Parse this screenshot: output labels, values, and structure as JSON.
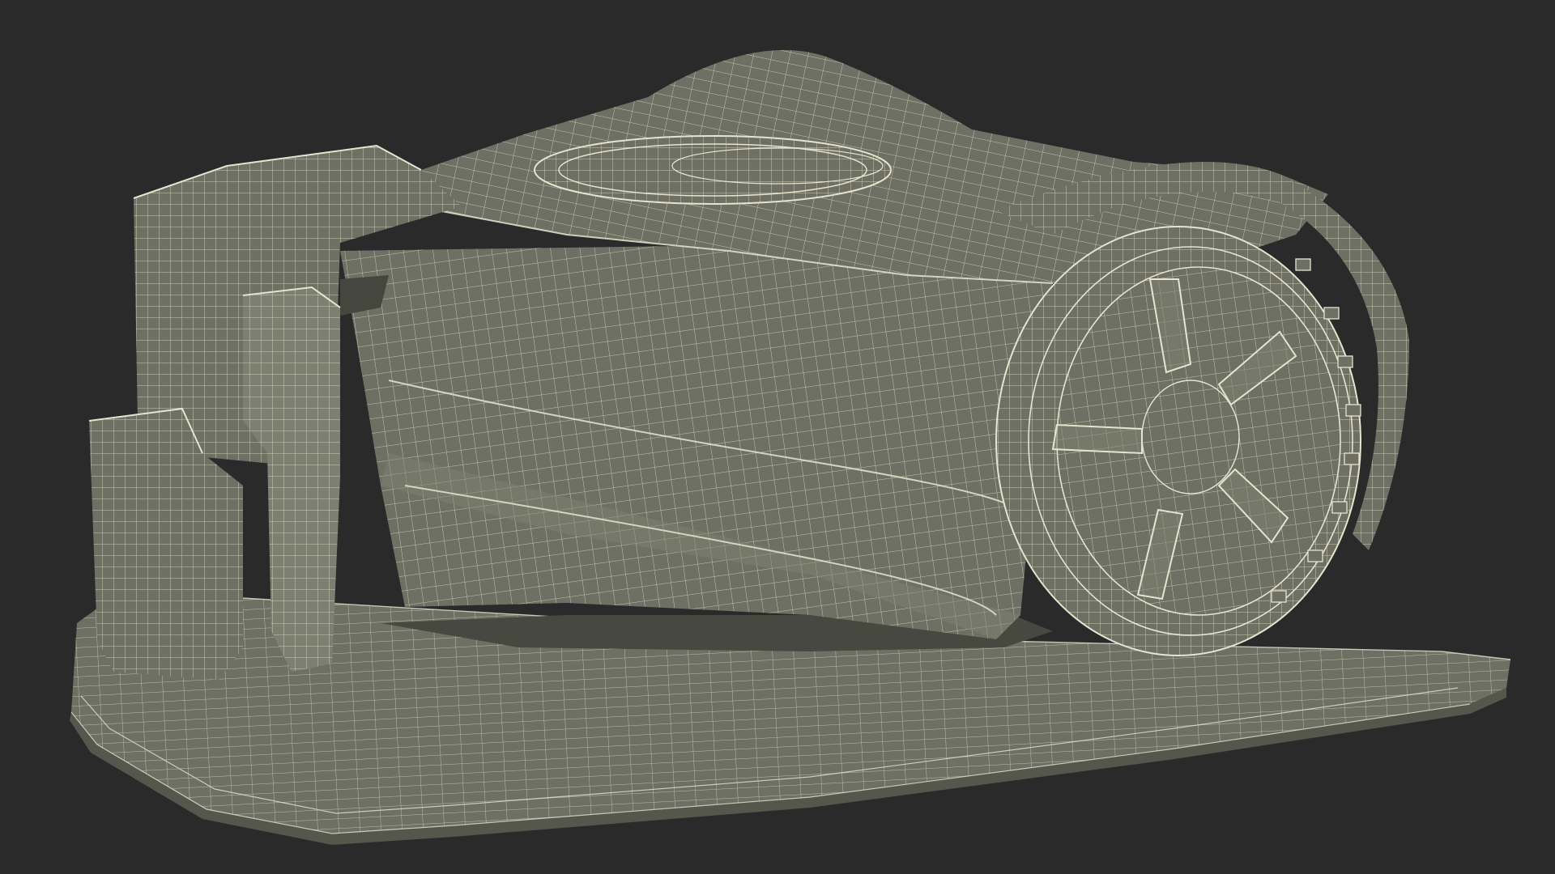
{
  "scene": {
    "subject": "robotic-lawn-mower-wireframe",
    "colors": {
      "background": "#2a2a2a",
      "surface": "#6e7063",
      "surface_dark": "#55574c",
      "surface_light": "#7d7f71",
      "wire": "#e6e4cf",
      "shadow": "#47483f"
    }
  }
}
